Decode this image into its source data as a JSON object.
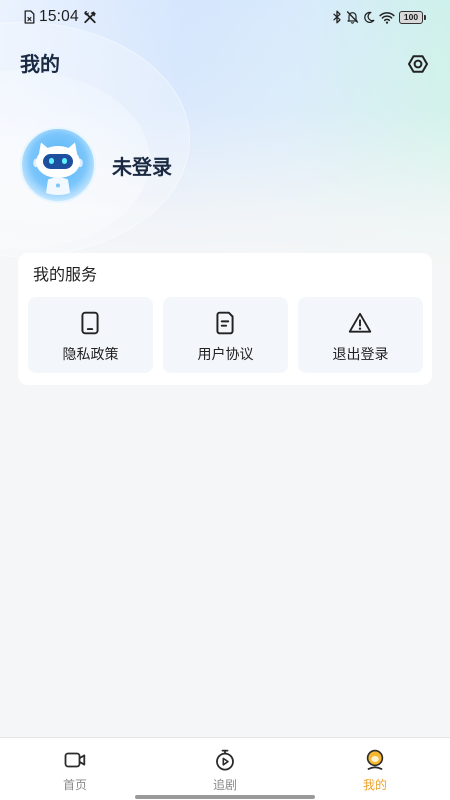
{
  "status_bar": {
    "time": "15:04",
    "battery": "100",
    "left_icons": [
      "file-icon",
      "tools-icon"
    ],
    "right_icons": [
      "bluetooth-icon",
      "bell-off-icon",
      "moon-icon",
      "wifi-icon",
      "battery-icon"
    ]
  },
  "header": {
    "title": "我的",
    "settings_icon": "settings-icon"
  },
  "profile": {
    "login_status": "未登录",
    "avatar_icon": "robot-avatar"
  },
  "services": {
    "title": "我的服务",
    "items": [
      {
        "label": "隐私政策",
        "icon": "tablet-icon"
      },
      {
        "label": "用户协议",
        "icon": "document-icon"
      },
      {
        "label": "退出登录",
        "icon": "warning-icon"
      }
    ]
  },
  "tab_bar": {
    "items": [
      {
        "label": "首页",
        "icon": "video-camera-icon",
        "active": false
      },
      {
        "label": "追剧",
        "icon": "timer-play-icon",
        "active": false
      },
      {
        "label": "我的",
        "icon": "mine-face-icon",
        "active": true
      }
    ]
  },
  "colors": {
    "accent": "#efa22a",
    "text_primary": "#1b2a43",
    "tab_inactive": "#8a8a8a",
    "page_background": "#f5f6f7",
    "tile_background": "#f3f6fb"
  }
}
